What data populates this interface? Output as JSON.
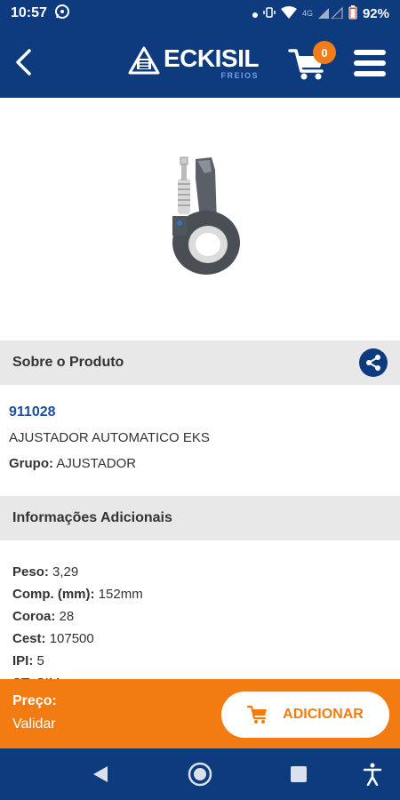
{
  "status_bar": {
    "time": "10:57",
    "network": "4G",
    "battery": "92%"
  },
  "header": {
    "logo_name": "ECKISIL",
    "logo_sub": "FREIOS",
    "cart_count": "0"
  },
  "product": {
    "section_title": "Sobre o Produto",
    "code": "911028",
    "name": "AJUSTADOR AUTOMATICO EKS",
    "group_label": "Grupo:",
    "group_value": "AJUSTADOR"
  },
  "additional": {
    "section_title": "Informações Adicionais",
    "rows": [
      {
        "label": "Peso:",
        "value": "3,29"
      },
      {
        "label": "Comp. (mm):",
        "value": "152mm"
      },
      {
        "label": "Coroa:",
        "value": "28"
      },
      {
        "label": "Cest:",
        "value": "107500"
      },
      {
        "label": "IPI:",
        "value": "5"
      },
      {
        "label": "ST:",
        "value": "SIM"
      }
    ]
  },
  "price_bar": {
    "label": "Preço:",
    "value": "Validar",
    "add_button": "ADICIONAR"
  },
  "colors": {
    "primary": "#0d3b7d",
    "accent": "#f37c12",
    "code_blue": "#1b4e9b"
  }
}
